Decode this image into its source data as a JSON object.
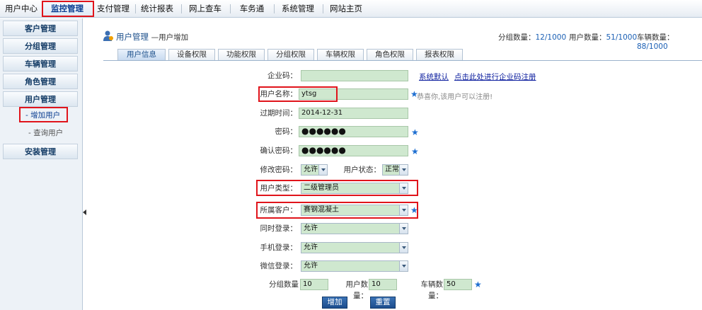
{
  "topnav": {
    "items": [
      "用户中心",
      "监控管理",
      "支付管理",
      "统计报表",
      "网上查车",
      "车务通",
      "系统管理",
      "网站主页"
    ]
  },
  "sidebar": {
    "sections": [
      "客户管理",
      "分组管理",
      "车辆管理",
      "角色管理",
      "用户管理"
    ],
    "subitems": [
      "- 增加用户",
      "- 查询用户"
    ],
    "install": "安装管理"
  },
  "header": {
    "title": "用户管理",
    "subtitle": "—用户增加",
    "stats": [
      {
        "label": "分组数量：",
        "value": "12/1000"
      },
      {
        "label": "用户数量：",
        "value": "51/1000"
      },
      {
        "label": "车辆数量：",
        "value": "88/1000"
      }
    ]
  },
  "tabs": [
    "用户信息",
    "设备权限",
    "功能权限",
    "分组权限",
    "车辆权限",
    "角色权限",
    "报表权限"
  ],
  "form": {
    "company_code_label": "企业码：",
    "company_code_value": "",
    "system_default_link": "系统默认",
    "register_link": "点击此处进行企业码注册",
    "username_label": "用户名称：",
    "username_value": "ytsg",
    "username_hint": "恭喜你,该用户可以注册!",
    "expire_label": "过期时间：",
    "expire_value": "2014-12-31",
    "password_label": "密码：",
    "password_value": "●●●●●●",
    "confirm_label": "确认密码：",
    "confirm_value": "●●●●●●",
    "modify_pwd_label": "修改密码：",
    "modify_pwd_value": "允许",
    "user_status_label": "用户状态：",
    "user_status_value": "正常",
    "user_type_label": "用户类型：",
    "user_type_value": "二级管理员",
    "customer_label": "所属客户：",
    "customer_value": "赛钢混凝土",
    "concurrent_label": "同时登录：",
    "concurrent_value": "允许",
    "mobile_label": "手机登录：",
    "mobile_value": "允许",
    "wechat_label": "微信登录：",
    "wechat_value": "允许",
    "group_count_label": "分组数量",
    "group_count_value": "10",
    "user_count_label": "用户数量：",
    "user_count_value": "10",
    "vehicle_count_label": "车辆数量：",
    "vehicle_count_value": "50",
    "add_button": "增加",
    "reset_button": "重置",
    "star": "★"
  },
  "colors": {
    "highlight": "#e0141b",
    "accent": "#1f6fd1",
    "field": "#cfe8cf"
  }
}
